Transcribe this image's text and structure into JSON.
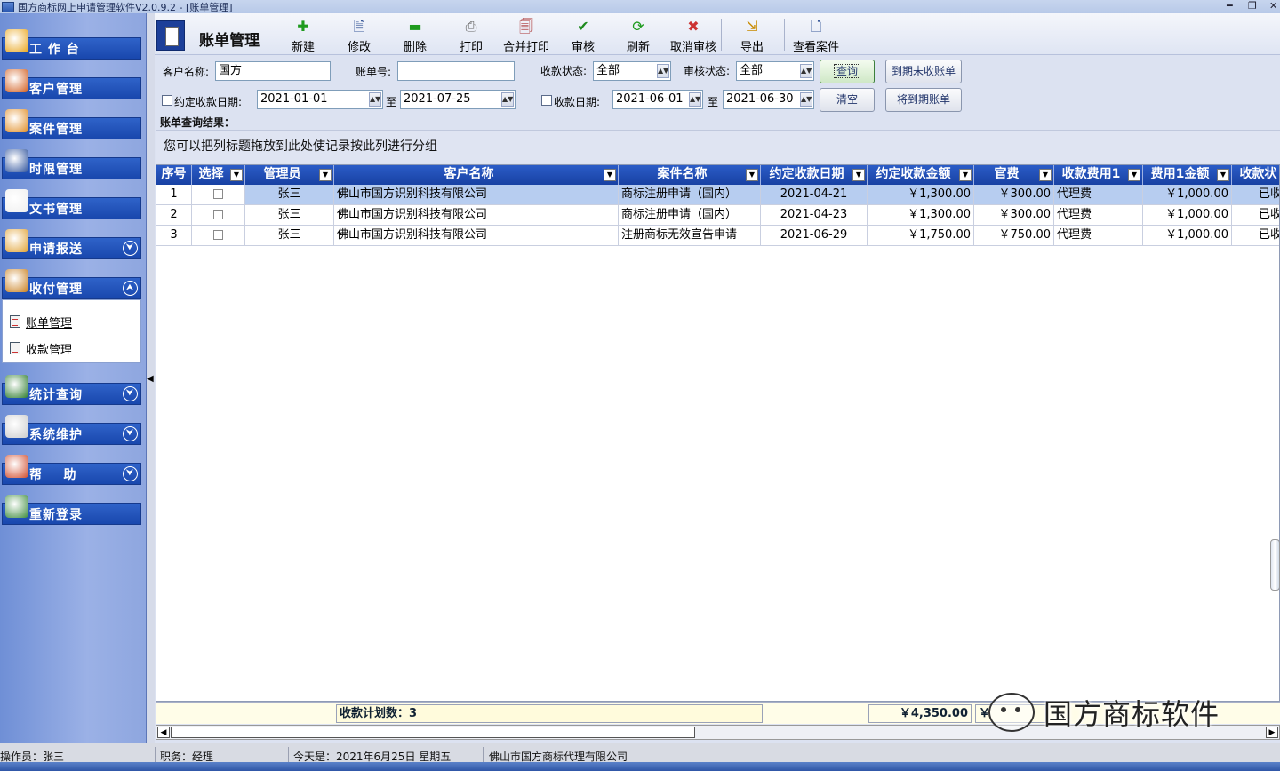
{
  "window": {
    "title": "国方商标网上申请管理软件V2.0.9.2 - [账单管理]"
  },
  "sidebar": {
    "items": [
      {
        "label": "工 作 台",
        "icon": "dashboard-icon",
        "chevron": ""
      },
      {
        "label": "客户管理",
        "icon": "users-icon",
        "chevron": ""
      },
      {
        "label": "案件管理",
        "icon": "box-icon",
        "chevron": ""
      },
      {
        "label": "时限管理",
        "icon": "clock-icon",
        "chevron": ""
      },
      {
        "label": "文书管理",
        "icon": "document-icon",
        "chevron": ""
      },
      {
        "label": "申请报送",
        "icon": "pen-icon",
        "chevron": "⮟"
      },
      {
        "label": "收付管理",
        "icon": "edit-icon",
        "chevron": "⮝"
      },
      {
        "label": "统计查询",
        "icon": "chart-icon",
        "chevron": "⮟"
      },
      {
        "label": "系统维护",
        "icon": "tools-icon",
        "chevron": "⮟"
      },
      {
        "label": "帮    助",
        "icon": "help-icon",
        "chevron": "⮟"
      },
      {
        "label": "重新登录",
        "icon": "login-icon",
        "chevron": ""
      }
    ],
    "submenu": [
      {
        "label": "账单管理",
        "selected": true
      },
      {
        "label": "收款管理",
        "selected": false
      }
    ]
  },
  "toolbar": {
    "title": "账单管理",
    "buttons": [
      {
        "label": "新建",
        "icon": "add-icon",
        "glyph": "✚",
        "color": "#1e9a1e"
      },
      {
        "label": "修改",
        "icon": "edit-doc-icon",
        "glyph": "🗎",
        "color": "#3a5a9a"
      },
      {
        "label": "删除",
        "icon": "delete-icon",
        "glyph": "▬",
        "color": "#1e9a1e"
      },
      {
        "label": "打印",
        "icon": "print-icon",
        "glyph": "⎙",
        "color": "#666666"
      },
      {
        "label": "合并打印",
        "icon": "merge-print-icon",
        "glyph": "🗐",
        "color": "#a33"
      },
      {
        "label": "审核",
        "icon": "check-icon",
        "glyph": "✔",
        "color": "#1e8a1e"
      },
      {
        "label": "刷新",
        "icon": "refresh-icon",
        "glyph": "⟳",
        "color": "#1e9a1e"
      },
      {
        "label": "取消审核",
        "icon": "cancel-audit-icon",
        "glyph": "✖",
        "color": "#c33"
      },
      {
        "label": "导出",
        "icon": "export-icon",
        "glyph": "⇲",
        "color": "#c88a00"
      },
      {
        "label": "查看案件",
        "icon": "view-case-icon",
        "glyph": "🗋",
        "color": "#3a5a9a"
      }
    ]
  },
  "filters": {
    "customer_label": "客户名称:",
    "customer_value": "国方",
    "bill_no_label": "账单号:",
    "bill_no_value": "",
    "collect_status_label": "收款状态:",
    "collect_status_value": "全部",
    "audit_status_label": "审核状态:",
    "audit_status_value": "全部",
    "query_button": "查询",
    "due_unpaid_button": "到期未收账单",
    "agreed_date_label": "约定收款日期:",
    "agreed_from": "2021-01-01",
    "to_label": "至",
    "agreed_to": "2021-07-25",
    "collect_date_label": "收款日期:",
    "collect_from": "2021-06-01",
    "collect_to": "2021-06-30",
    "clear_button": "清空",
    "due_soon_button": "将到期账单"
  },
  "results": {
    "section_label": "账单查询结果：",
    "group_hint": "您可以把列标题拖放到此处使记录按此列进行分组",
    "columns": [
      "序号",
      "选择",
      "管理员",
      "客户名称",
      "案件名称",
      "约定收款日期",
      "约定收款金额",
      "官费",
      "收款费用1",
      "费用1金额",
      "收款状"
    ],
    "rows": [
      {
        "no": "1",
        "manager": "张三",
        "customer": "佛山市国方识别科技有限公司",
        "case": "商标注册申请（国内）",
        "date": "2021-04-21",
        "amount": "￥1,300.00",
        "fee": "￥300.00",
        "item1": "代理费",
        "item1_amount": "￥1,000.00",
        "status": "已收"
      },
      {
        "no": "2",
        "manager": "张三",
        "customer": "佛山市国方识别科技有限公司",
        "case": "商标注册申请（国内）",
        "date": "2021-04-23",
        "amount": "￥1,300.00",
        "fee": "￥300.00",
        "item1": "代理费",
        "item1_amount": "￥1,000.00",
        "status": "已收"
      },
      {
        "no": "3",
        "manager": "张三",
        "customer": "佛山市国方识别科技有限公司",
        "case": "注册商标无效宣告申请",
        "date": "2021-06-29",
        "amount": "￥1,750.00",
        "fee": "￥750.00",
        "item1": "代理费",
        "item1_amount": "￥1,000.00",
        "status": "已收"
      }
    ],
    "footer": {
      "count_label": "收款计划数：3",
      "total_amount": "￥4,350.00",
      "total_fee_partial": "￥"
    }
  },
  "status": {
    "operator": "操作员：张三",
    "role": "职务：经理",
    "today": "今天是：2021年6月25日    星期五",
    "company": "佛山市国方商标代理有限公司"
  },
  "watermark": {
    "text": "国方商标软件"
  }
}
